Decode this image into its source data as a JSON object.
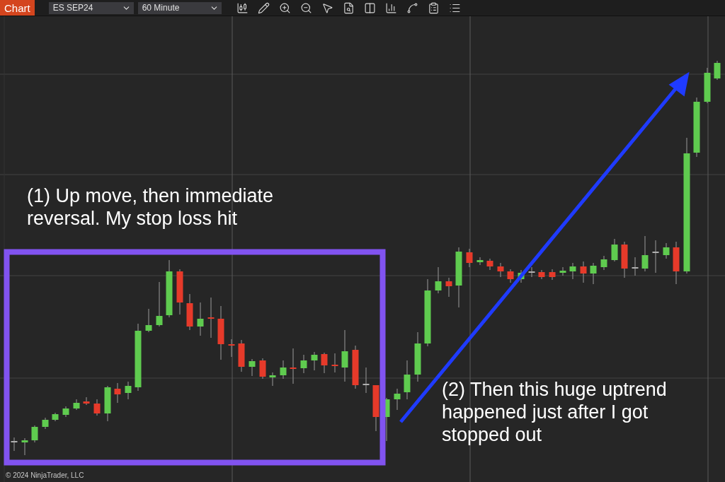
{
  "toolbar": {
    "app_label": "Chart",
    "instrument": "ES SEP24",
    "interval": "60 Minute"
  },
  "annotations": [
    {
      "kind": "note",
      "text": "(1) Up move, then immediate reversal. My stop loss hit"
    },
    {
      "kind": "note",
      "text": "(2) Then this huge uptrend happened just after I got stopped out"
    }
  ],
  "copyright": "© 2024 NinjaTrader, LLC"
}
